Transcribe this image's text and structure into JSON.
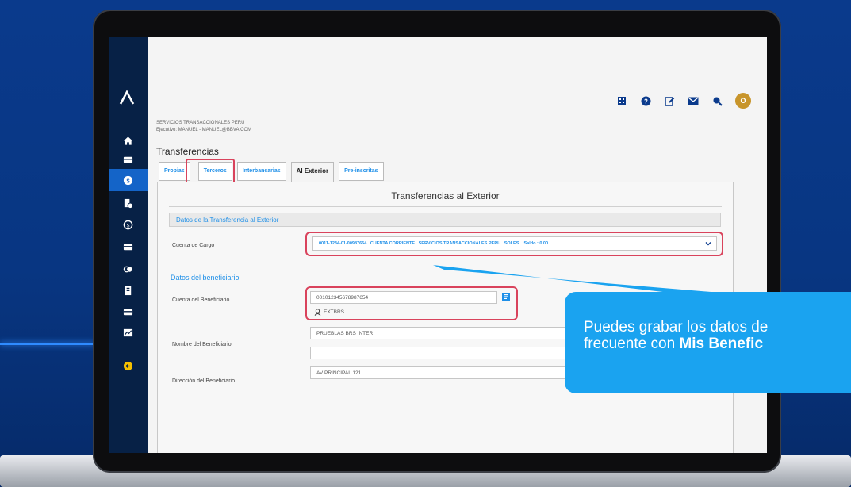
{
  "sidebar": {
    "items": [
      "home",
      "card",
      "money-active",
      "file-money",
      "dollar-circle",
      "card-2",
      "toggle",
      "building",
      "card-3",
      "chart",
      "exit"
    ]
  },
  "topbar": {
    "avatar_initial": "O"
  },
  "company": {
    "name": "SERVICIOS TRANSACCIONALES PERU",
    "executive": "Ejecutivo: MANUEL - MANUEL@BBVA.COM"
  },
  "page_title": "Transferencias",
  "tabs": [
    {
      "label": "Propias"
    },
    {
      "label": "Terceros"
    },
    {
      "label": "Interbancarias"
    },
    {
      "label": "Al Exterior"
    },
    {
      "label": "Pre-inscritas"
    }
  ],
  "panel": {
    "title": "Transferencias al Exterior",
    "section1": "Datos de la Transferencia al Exterior",
    "cuenta_cargo_label": "Cuenta de Cargo",
    "cuenta_cargo_value": "0011-1234-01-00987654...CUENTA CORRIENTE...SERVICIOS TRANSACCIONALES PERU...SOLES....Saldo : 0.00",
    "section2": "Datos del beneficiario",
    "cuenta_benef_label": "Cuenta del Beneficiario",
    "cuenta_benef_value": "001012345678987654",
    "benef_code": "EXTBRS",
    "nombre_label": "Nombre del Beneficiario",
    "nombre_value": "PRUEBLAS BRS INTER",
    "direccion_label": "Dirección del Beneficiario",
    "direccion_value": "AV PRINCIPAL 121"
  },
  "callout": {
    "line1": "Puedes grabar los datos de",
    "line2_prefix": "frecuente con ",
    "line2_bold": "Mis Benefic"
  },
  "colors": {
    "accent": "#1e8fe8",
    "sidebar": "#072146",
    "highlight": "#d9435c",
    "callout": "#1aa3f0"
  }
}
